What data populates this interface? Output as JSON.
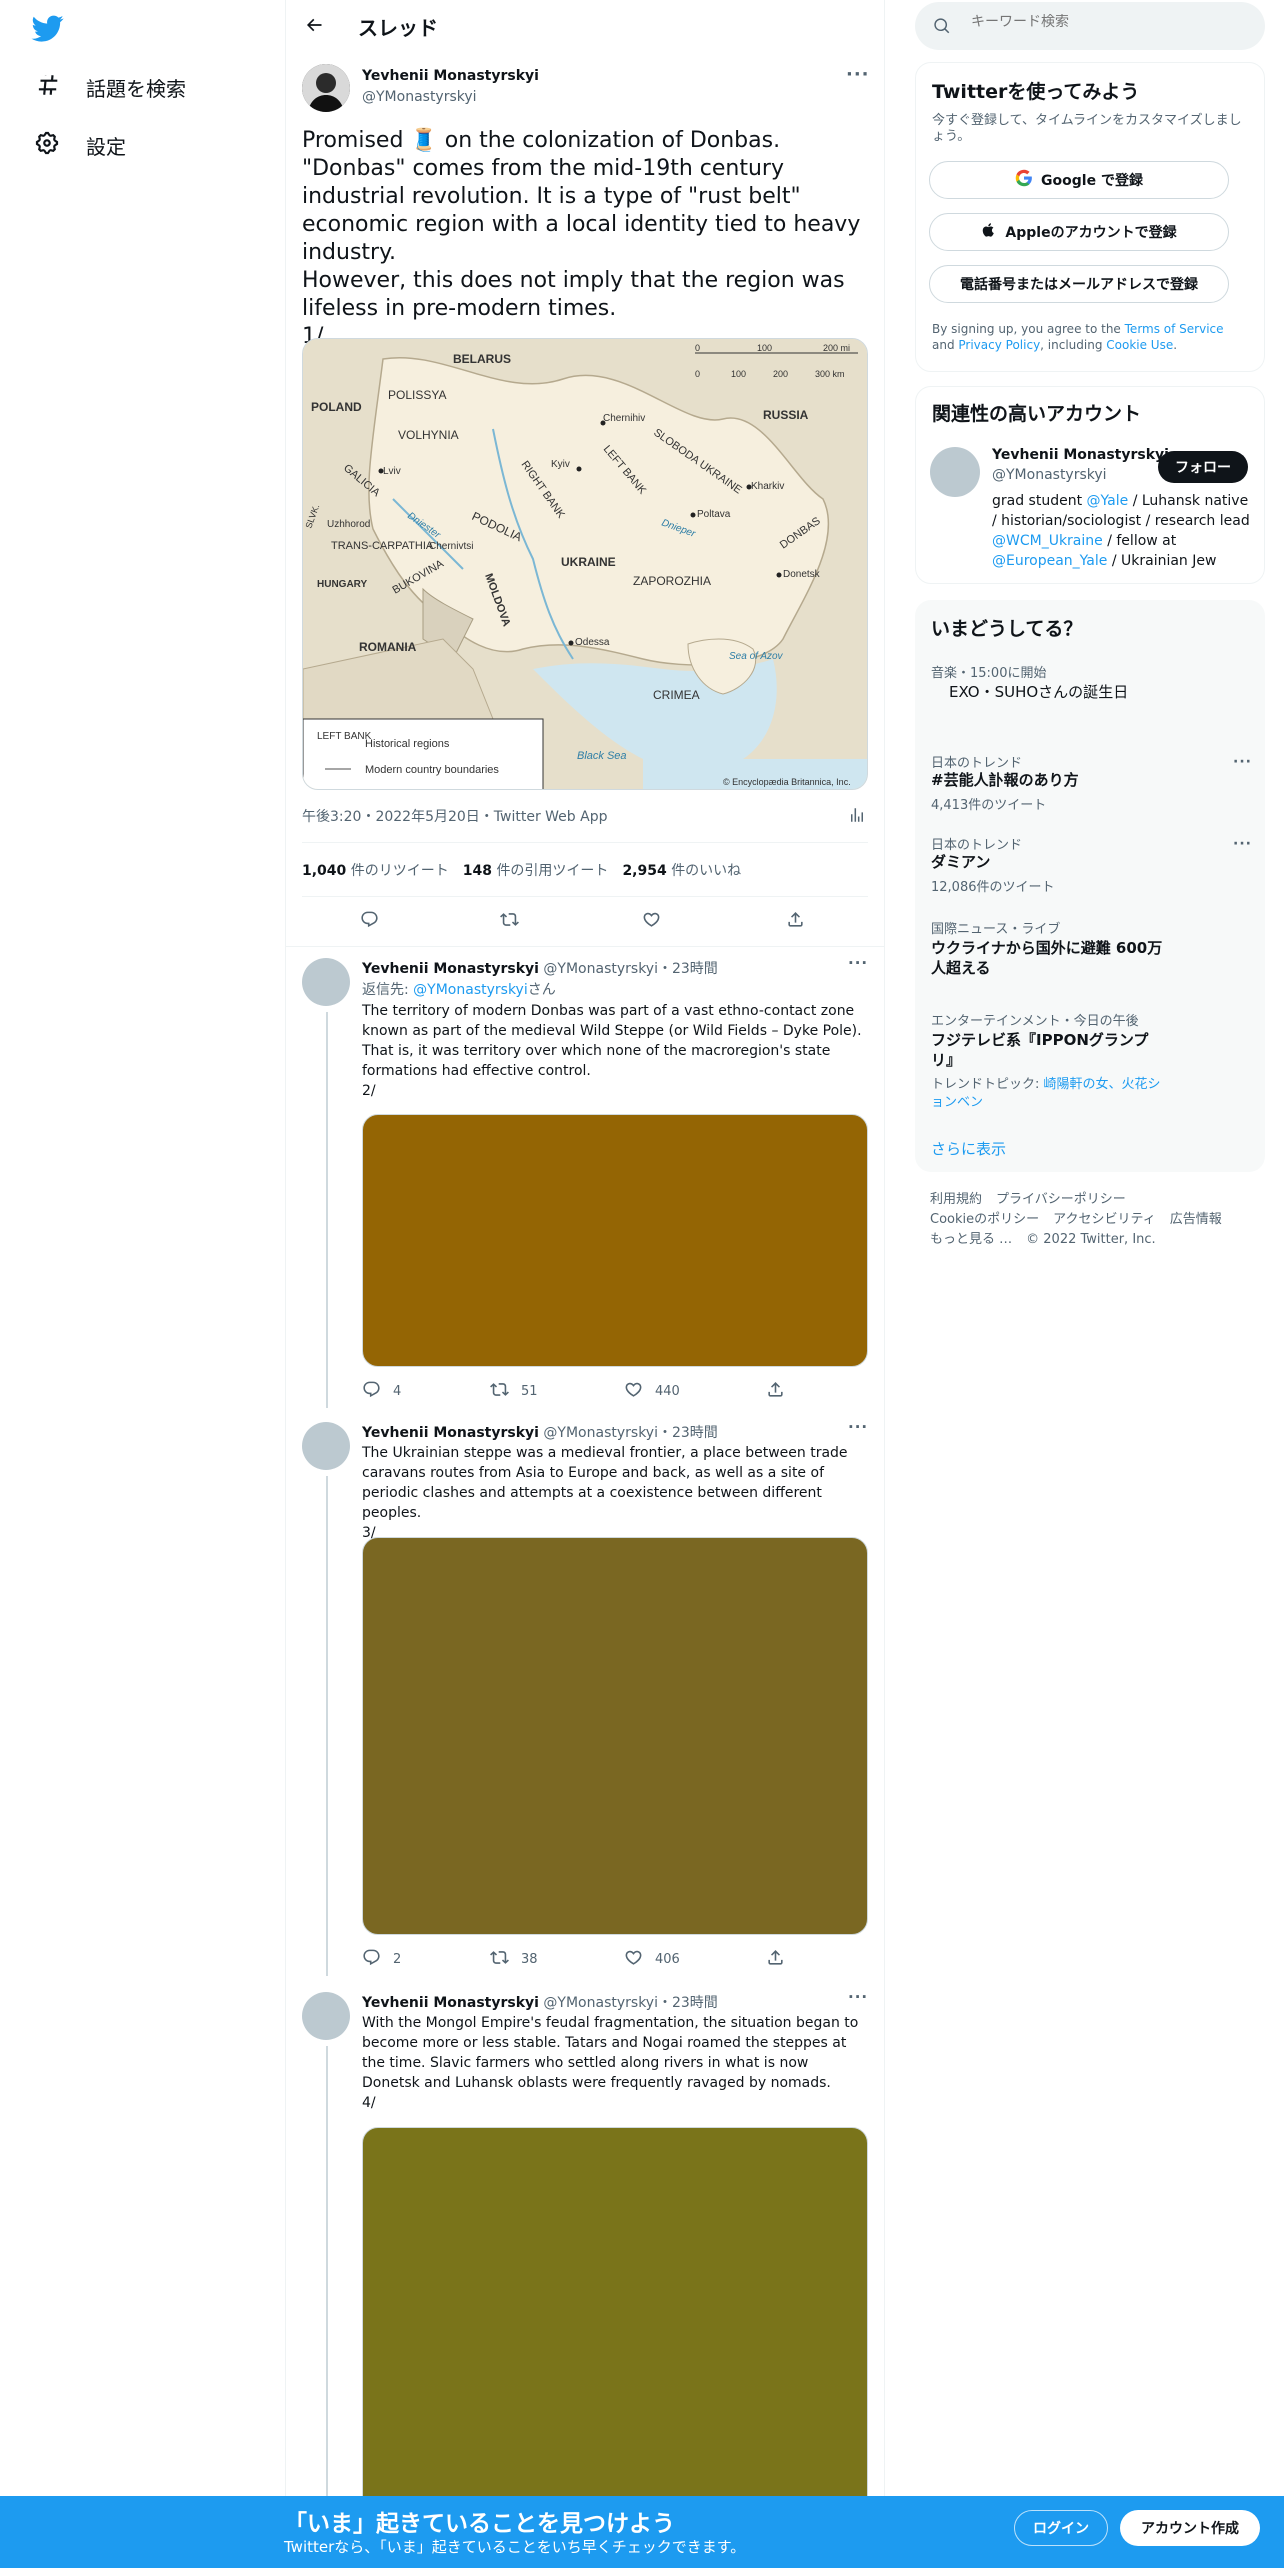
{
  "nav": {
    "explore_label": "話題を検索",
    "settings_label": "設定"
  },
  "header": {
    "title": "スレッド"
  },
  "main_tweet": {
    "author_name": "Yevhenii Monastyrskyi",
    "author_handle": "@YMonastyrskyi",
    "text_lines": [
      "Promised 🧵 on the colonization of Donbas.",
      "\"Donbas\" comes from the mid-19th century industrial revolution. It is a type of \"rust belt\" economic region with a local identity tied to heavy industry.",
      "However, this does not imply that the region was lifeless in pre-modern times.",
      "1/"
    ],
    "timestamp": "午後3:20・2022年5月20日・Twitter Web App",
    "retweets": "1,040",
    "retweets_label": "件のリツイート",
    "quotes": "148",
    "quotes_label": "件の引用ツイート",
    "likes": "2,954",
    "likes_label": "件のいいね"
  },
  "map": {
    "labels": {
      "belarus": "BELARUS",
      "russia": "RUSSIA",
      "poland": "POLAND",
      "polissya": "POLISSYA",
      "volhynia": "VOLHYNIA",
      "chernihiv": "Chernihiv",
      "kyiv": "Kyiv",
      "left_bank": "LEFT BANK",
      "sloboda_ukraine": "SLOBODA UKRAINE",
      "kharkiv": "Kharkiv",
      "lviv": "Lviv",
      "galicia": "GALICIA",
      "right_bank": "RIGHT BANK",
      "poltava": "Poltava",
      "donbas": "DONBAS",
      "slvk": "SLVK.",
      "uzhhorod": "Uzhhorod",
      "dniester": "Dniester",
      "dnieper": "Dnieper",
      "trans_carpathia": "TRANS-CARPATHIA",
      "chernivtsi": "Chernivtsi",
      "podolia": "PODOLIA",
      "ukraine": "UKRAINE",
      "donetsk": "Donetsk",
      "bukovina": "BUKOVINA",
      "zaporozhia": "ZAPOROZHIA",
      "hungary": "HUNGARY",
      "moldova": "MOLDOVA",
      "odessa": "Odessa",
      "romania": "ROMANIA",
      "sea_of_azov": "Sea of Azov",
      "crimea": "CRIMEA",
      "black_sea": "Black Sea",
      "scale_mi_0": "0",
      "scale_mi_100": "100",
      "scale_mi_200": "200 mi",
      "scale_km_0": "0",
      "scale_km_100": "100",
      "scale_km_200": "200",
      "scale_km_300": "300 km",
      "legend_symbol": "LEFT BANK",
      "legend_historical": "Historical regions",
      "legend_boundaries": "Modern country boundaries",
      "credit": "© Encyclopædia Britannica, Inc."
    }
  },
  "replies": [
    {
      "author_name": "Yevhenii Monastyrskyi",
      "meta": "@YMonastyrskyi・23時間",
      "reply_prefix": "返信先: ",
      "reply_handle": "@YMonastyrskyi",
      "reply_suffix": "さん",
      "text": "The territory of modern Donbas was part of a vast ethno-contact zone known as part of the medieval Wild Steppe (or Wild Fields – Dyke Pole). That is, it was territory over which none of the macroregion's state formations had effective control.",
      "number": "2/",
      "replies": "4",
      "retweets": "51",
      "likes": "440",
      "media_color": "#946504"
    },
    {
      "author_name": "Yevhenii Monastyrskyi",
      "meta": "@YMonastyrskyi・23時間",
      "text": "The Ukrainian steppe was a medieval frontier, a place between trade caravans routes from Asia to Europe and back, as well as a site of periodic clashes and attempts at a coexistence between different peoples.",
      "number": "3/",
      "replies": "2",
      "retweets": "38",
      "likes": "406",
      "media_color": "#7a6722"
    },
    {
      "author_name": "Yevhenii Monastyrskyi",
      "meta": "@YMonastyrskyi・23時間",
      "text": "With the Mongol Empire's feudal fragmentation, the situation began to become more or less stable. Tatars and Nogai roamed the steppes at the time. Slavic farmers who settled along rivers in what is now Donetsk and Luhansk oblasts were frequently ravaged by nomads.",
      "number": "4/",
      "media_color": "#7a741a"
    }
  ],
  "search": {
    "placeholder": "キーワード検索"
  },
  "signup_panel": {
    "title": "Twitterを使ってみよう",
    "subtitle": "今すぐ登録して、タイムラインをカスタマイズしましょう。",
    "google_label": "Google で登録",
    "apple_label": "Appleのアカウントで登録",
    "phone_label": "電話番号またはメールアドレスで登録",
    "terms_prefix": "By signing up, you agree to the ",
    "terms_link": "Terms of Service",
    "terms_and": " and ",
    "privacy_link": "Privacy Policy",
    "terms_including": ", including ",
    "cookie_link": "Cookie Use",
    "terms_end": "."
  },
  "relevant_panel": {
    "title": "関連性の高いアカウント",
    "name": "Yevhenii Monastyrskyi",
    "handle": "@YMonastyrskyi",
    "follow_label": "フォロー",
    "bio_1": "grad student ",
    "bio_yale": "@Yale",
    "bio_2": " / Luhansk native / historian/sociologist / research lead ",
    "bio_wcm": "@WCM_Ukraine",
    "bio_3": " / fellow at ",
    "bio_eu": "@European_Yale",
    "bio_4": " / Ukrainian Jew"
  },
  "trends_panel": {
    "title": "いまどうしてる？",
    "items": [
      {
        "category": "音楽・15:00に開始",
        "title": "EXO・SUHOさんの誕生日"
      },
      {
        "category": "日本のトレンド",
        "title": "#芸能人訃報のあり方",
        "count": "4,413件のツイート"
      },
      {
        "category": "日本のトレンド",
        "title": "ダミアン",
        "count": "12,086件のツイート"
      },
      {
        "category": "国際ニュース・ライブ",
        "title": "ウクライナから国外に避難 600万人超える"
      },
      {
        "category": "エンターテインメント・今日の午後",
        "title": "フジテレビ系『IPPONグランプリ』",
        "topic_prefix": "トレンドトピック: ",
        "topic": "崎陽軒の女、火花ションベン"
      }
    ],
    "show_more": "さらに表示"
  },
  "footer": {
    "terms": "利用規約",
    "privacy": "プライバシーポリシー",
    "cookie": "Cookieのポリシー",
    "accessibility": "アクセシビリティ",
    "ads": "広告情報",
    "more": "もっと見る …",
    "copyright": "© 2022 Twitter, Inc."
  },
  "bottom_bar": {
    "title": "「いま」起きていることを見つけよう",
    "subtitle": "Twitterなら、「いま」起きていることをいち早くチェックできます。",
    "login_label": "ログイン",
    "signup_label": "アカウント作成"
  },
  "colors": {
    "accent": "#1d9bf0",
    "text": "#0f1419",
    "muted": "#536471"
  }
}
